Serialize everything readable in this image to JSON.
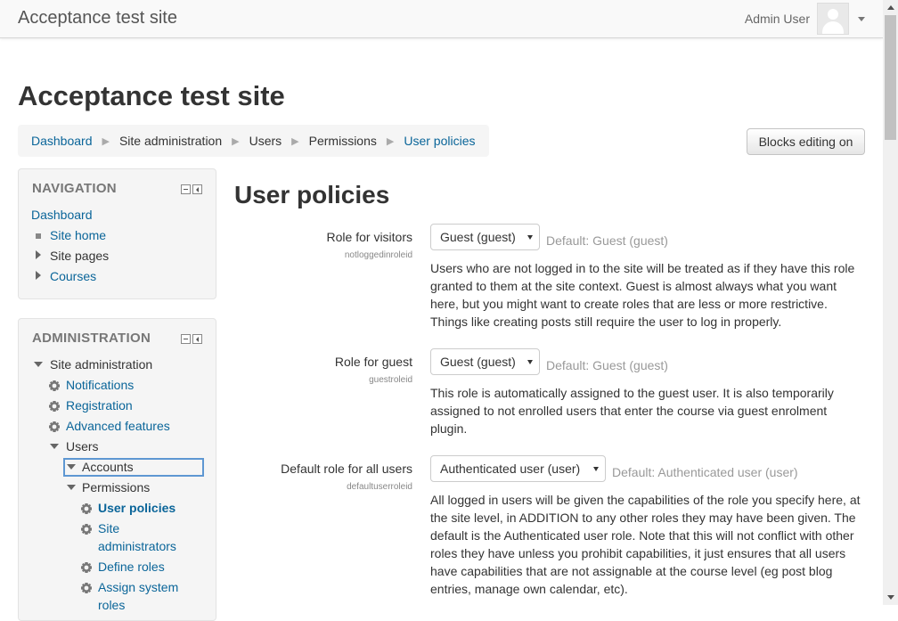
{
  "navbar": {
    "site_name": "Acceptance test site",
    "user_name": "Admin User"
  },
  "page": {
    "heading": "Acceptance test site",
    "breadcrumb": [
      "Dashboard",
      "Site administration",
      "Users",
      "Permissions",
      "User policies"
    ],
    "blocks_editing_button": "Blocks editing on"
  },
  "navigation_block": {
    "title": "NAVIGATION",
    "items": [
      "Dashboard",
      "Site home",
      "Site pages",
      "Courses"
    ]
  },
  "admin_block": {
    "title": "ADMINISTRATION",
    "items": [
      "Site administration",
      "Notifications",
      "Registration",
      "Advanced features",
      "Users",
      "Accounts",
      "Permissions",
      "User policies",
      "Site",
      "administrators",
      "Define roles",
      "Assign system",
      "roles"
    ]
  },
  "main": {
    "heading": "User policies",
    "settings": [
      {
        "label": "Role for visitors",
        "name": "notloggedinroleid",
        "value": "Guest (guest)",
        "default": "Default: Guest (guest)",
        "description": "Users who are not logged in to the site will be treated as if they have this role granted to them at the site context. Guest is almost always what you want here, but you might want to create roles that are less or more restrictive. Things like creating posts still require the user to log in properly."
      },
      {
        "label": "Role for guest",
        "name": "guestroleid",
        "value": "Guest (guest)",
        "default": "Default: Guest (guest)",
        "description": "This role is automatically assigned to the guest user. It is also temporarily assigned to not enrolled users that enter the course via guest enrolment plugin."
      },
      {
        "label": "Default role for all users",
        "name": "defaultuserroleid",
        "value": "Authenticated user (user)",
        "default": "Default: Authenticated user (user)",
        "description": "All logged in users will be given the capabilities of the role you specify here, at the site level, in ADDITION to any other roles they may have been given. The default is the Authenticated user role. Note that this will not conflict with other roles they have unless you prohibit capabilities, it just ensures that all users have capabilities that are not assignable at the course level (eg post blog entries, manage own calendar, etc)."
      }
    ]
  }
}
